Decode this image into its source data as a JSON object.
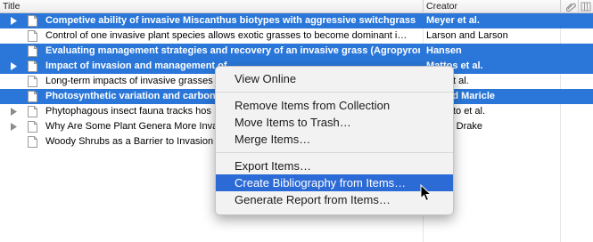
{
  "header": {
    "title_label": "Title",
    "creator_label": "Creator",
    "attachment_icon": "paperclip-icon",
    "column_options_icon": "column-picker-icon"
  },
  "items": [
    {
      "title": "Competive ability of invasive Miscanthus biotypes with aggressive switchgrass",
      "creator": "Meyer et al.",
      "selected": true,
      "has_children": true
    },
    {
      "title": "Control of one invasive plant species allows exotic grasses to become dominant i…",
      "creator": "Larson and Larson",
      "selected": false,
      "has_children": false
    },
    {
      "title": "Evaluating management strategies and recovery of an invasive grass (Agropyron …",
      "creator": "Hansen",
      "selected": true,
      "has_children": false
    },
    {
      "title": "Impact of invasion and management of",
      "creator": "Mattos et al.",
      "selected": true,
      "has_children": true
    },
    {
      "title": "Long-term impacts of invasive grasses",
      "creator": "onio et al.",
      "selected": false,
      "has_children": false
    },
    {
      "title": "Photosynthetic variation and carbon is",
      "creator": "ng and Maricle",
      "selected": true,
      "has_children": false
    },
    {
      "title": "Phytophagous insect fauna tracks hos",
      "creator": "da-Neto et al.",
      "selected": false,
      "has_children": true
    },
    {
      "title": "Why Are Some Plant Genera More Inva",
      "creator": "dt and Drake",
      "selected": false,
      "has_children": true
    },
    {
      "title": "Woody Shrubs as a Barrier to Invasion",
      "creator": "et al.",
      "selected": false,
      "has_children": false
    }
  ],
  "context_menu": {
    "view_online": "View Online",
    "remove_items": "Remove Items from Collection",
    "move_to_trash": "Move Items to Trash…",
    "merge_items": "Merge Items…",
    "export_items": "Export Items…",
    "create_bibliography": "Create Bibliography from Items…",
    "generate_report": "Generate Report from Items…"
  },
  "colors": {
    "selection": "#2a77d9",
    "menu_highlight": "#2c6bd6",
    "menu_background": "#f2f2f2"
  }
}
